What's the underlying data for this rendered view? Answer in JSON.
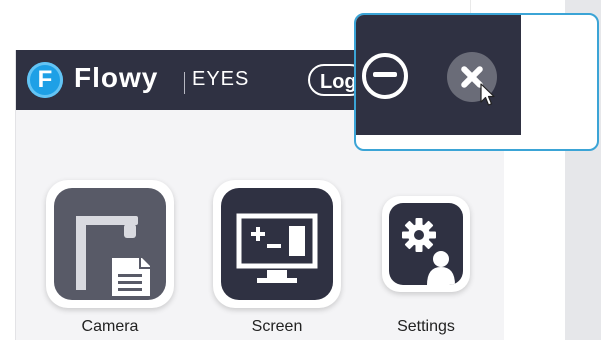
{
  "header": {
    "logo_letter": "F",
    "brand": "Flowy",
    "product": "EYES",
    "logout_label": "Logout"
  },
  "tiles": [
    {
      "label": "Camera",
      "icon": "document-camera-icon"
    },
    {
      "label": "Screen",
      "icon": "screen-capture-icon"
    },
    {
      "label": "Settings",
      "icon": "settings-user-icon"
    }
  ],
  "window_controls": {
    "minimize_icon": "minimize-icon",
    "close_icon": "close-icon"
  },
  "colors": {
    "header_bg": "#2f3142",
    "tile_bg": "#585a67",
    "accent_blue": "#1ea0e6",
    "popup_border": "#3ba4d6"
  }
}
